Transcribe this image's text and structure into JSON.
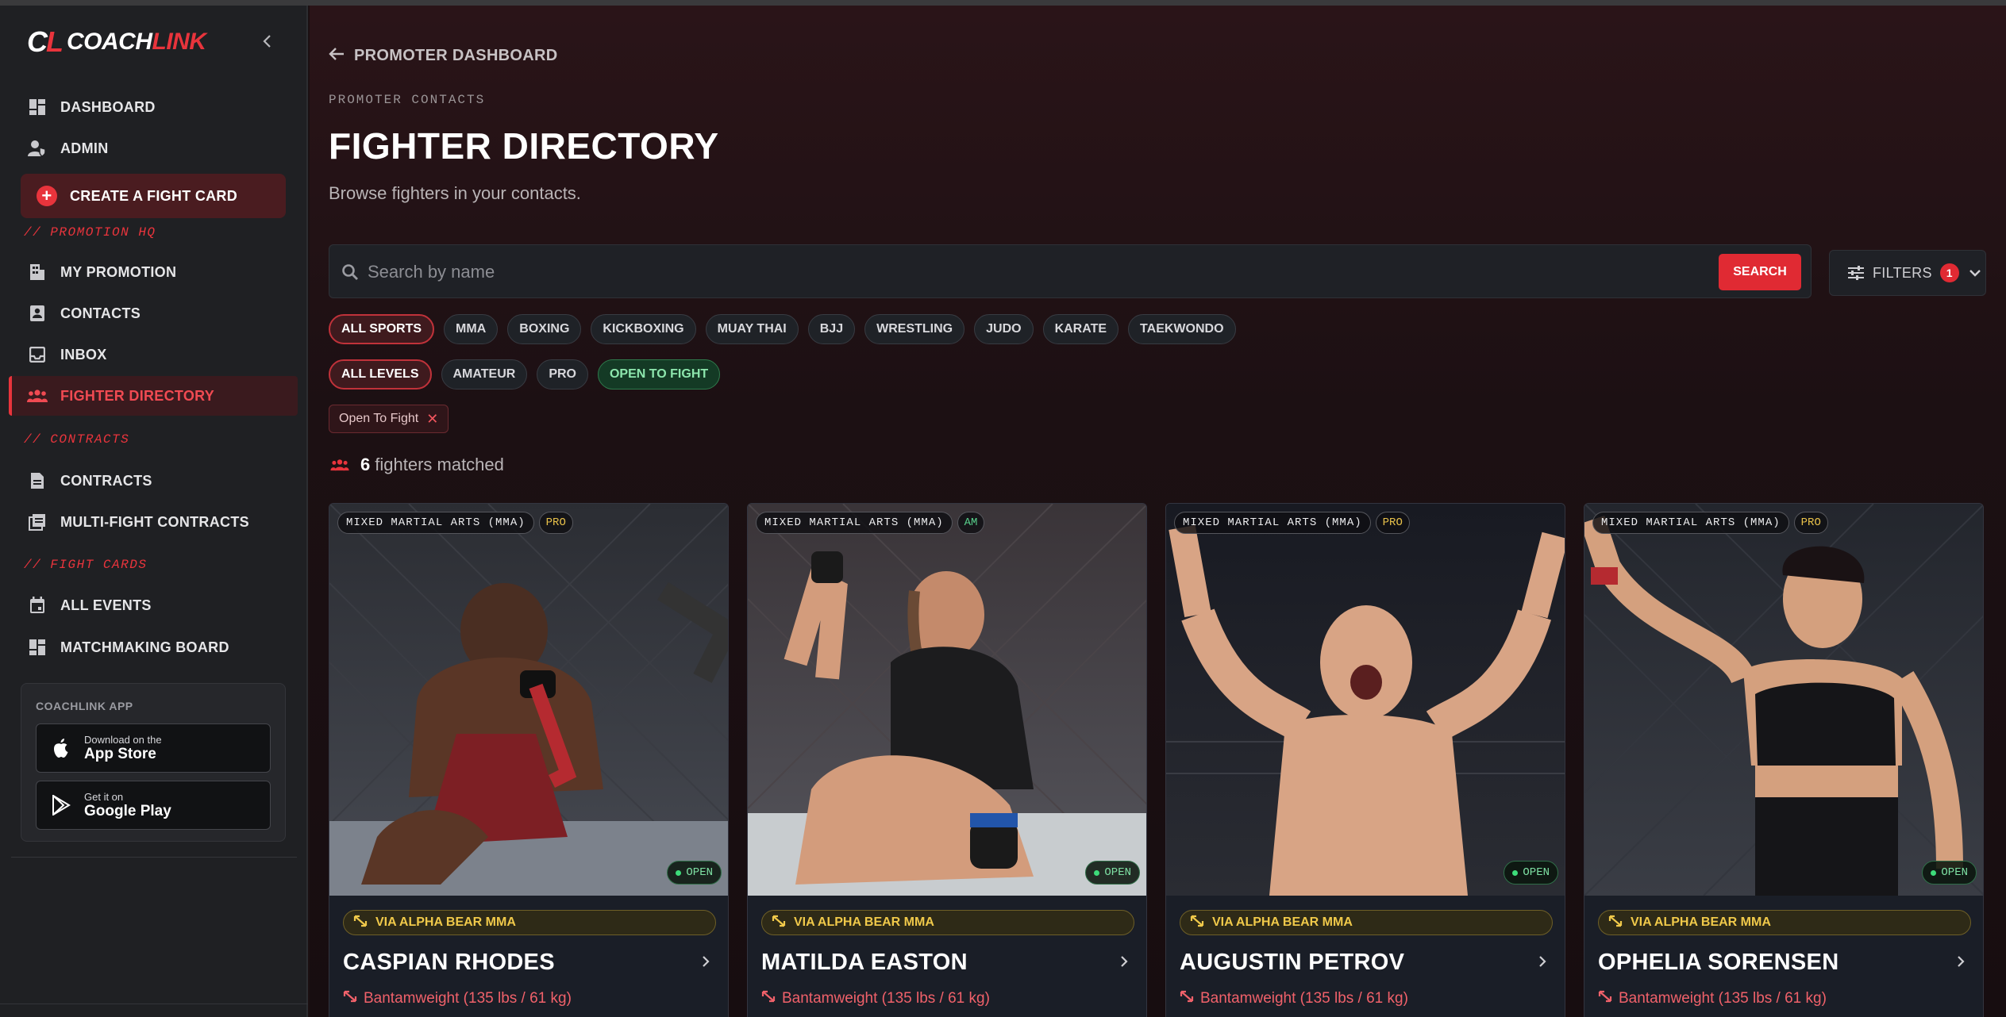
{
  "brand": {
    "mark": "CL",
    "name_a": "COACH",
    "name_b": "LINK"
  },
  "sidebar": {
    "items": [
      {
        "label": "DASHBOARD",
        "icon": "grid-icon"
      },
      {
        "label": "ADMIN",
        "icon": "user-shield-icon"
      }
    ],
    "create_label": "CREATE A FIGHT CARD",
    "sections": [
      {
        "label": "// PROMOTION HQ"
      },
      {
        "label": "// CONTRACTS"
      },
      {
        "label": "// FIGHT CARDS"
      }
    ],
    "promotion_items": [
      {
        "label": "MY PROMOTION"
      },
      {
        "label": "CONTACTS"
      },
      {
        "label": "INBOX"
      },
      {
        "label": "FIGHTER DIRECTORY"
      }
    ],
    "contract_items": [
      {
        "label": "CONTRACTS"
      },
      {
        "label": "MULTI-FIGHT CONTRACTS"
      }
    ],
    "fightcard_items": [
      {
        "label": "ALL EVENTS"
      },
      {
        "label": "MATCHMAKING BOARD"
      }
    ],
    "app": {
      "label": "COACHLINK APP",
      "appstore_small": "Download on the",
      "appstore_big": "App Store",
      "play_small": "Get it on",
      "play_big": "Google Play"
    }
  },
  "main": {
    "back_label": "PROMOTER DASHBOARD",
    "eyebrow": "PROMOTER CONTACTS",
    "title": "FIGHTER DIRECTORY",
    "subtitle": "Browse fighters in your contacts.",
    "search_placeholder": "Search by name",
    "search_button": "SEARCH",
    "filters_label": "FILTERS",
    "filters_count": "1",
    "sports": [
      "ALL SPORTS",
      "MMA",
      "BOXING",
      "KICKBOXING",
      "MUAY THAI",
      "BJJ",
      "WRESTLING",
      "JUDO",
      "KARATE",
      "TAEKWONDO"
    ],
    "levels": [
      "ALL LEVELS",
      "AMATEUR",
      "PRO",
      "OPEN TO FIGHT"
    ],
    "active_filter": "Open To Fight",
    "match_count": "6",
    "match_text": "fighters matched"
  },
  "cards": [
    {
      "sport": "MIXED MARTIAL ARTS (MMA)",
      "level": "PRO",
      "status": "OPEN",
      "via": "VIA ALPHA BEAR MMA",
      "name": "CASPIAN RHODES",
      "weight": "Bantamweight (135 lbs / 61 kg)"
    },
    {
      "sport": "MIXED MARTIAL ARTS (MMA)",
      "level": "AM",
      "status": "OPEN",
      "via": "VIA ALPHA BEAR MMA",
      "name": "MATILDA EASTON",
      "weight": "Bantamweight (135 lbs / 61 kg)"
    },
    {
      "sport": "MIXED MARTIAL ARTS (MMA)",
      "level": "PRO",
      "status": "OPEN",
      "via": "VIA ALPHA BEAR MMA",
      "name": "AUGUSTIN PETROV",
      "weight": "Bantamweight (135 lbs / 61 kg)"
    },
    {
      "sport": "MIXED MARTIAL ARTS (MMA)",
      "level": "PRO",
      "status": "OPEN",
      "via": "VIA ALPHA BEAR MMA",
      "name": "OPHELIA SORENSEN",
      "weight": "Bantamweight (135 lbs / 61 kg)"
    }
  ],
  "colors": {
    "accent": "#e8343c",
    "gold": "#f0c94a",
    "green": "#3ddc7a"
  }
}
